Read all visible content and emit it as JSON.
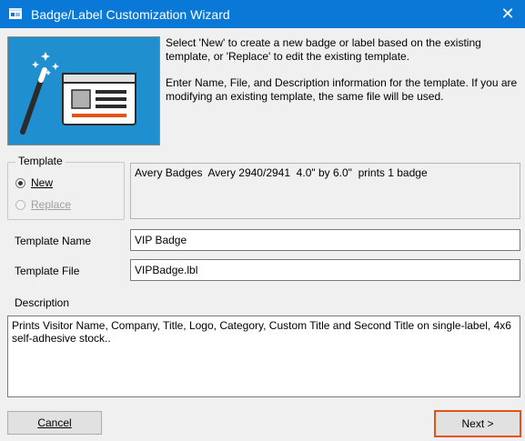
{
  "window": {
    "title": "Badge/Label Customization Wizard",
    "close_symbol": "✕",
    "icon": "app-window-icon"
  },
  "intro": {
    "line1": "Select 'New' to create a new badge or label based on the existing template, or 'Replace' to edit the existing template.",
    "line2": "Enter Name, File, and Description information for the template. If you are modifying an existing template, the same file will be used."
  },
  "template_group": {
    "legend": "Template",
    "new_label": "New",
    "replace_label": "Replace",
    "selected": "New"
  },
  "template_info": "Avery Badges  Avery 2940/2941  4.0\" by 6.0\"  prints 1 badge",
  "fields": {
    "name_label": "Template Name",
    "name_value": "VIP Badge",
    "file_label": "Template File",
    "file_value": "VIPBadge.lbl",
    "description_label": "Description",
    "description_value": "Prints Visitor Name, Company, Title, Logo, Category, Custom Title and Second Title on single-label, 4x6 self-adhesive stock.."
  },
  "buttons": {
    "cancel": "Cancel",
    "next": "Next >"
  },
  "colors": {
    "titlebar": "#0a78d7",
    "highlight": "#e3541b",
    "wizard_image_bg": "#1f8fd0"
  }
}
